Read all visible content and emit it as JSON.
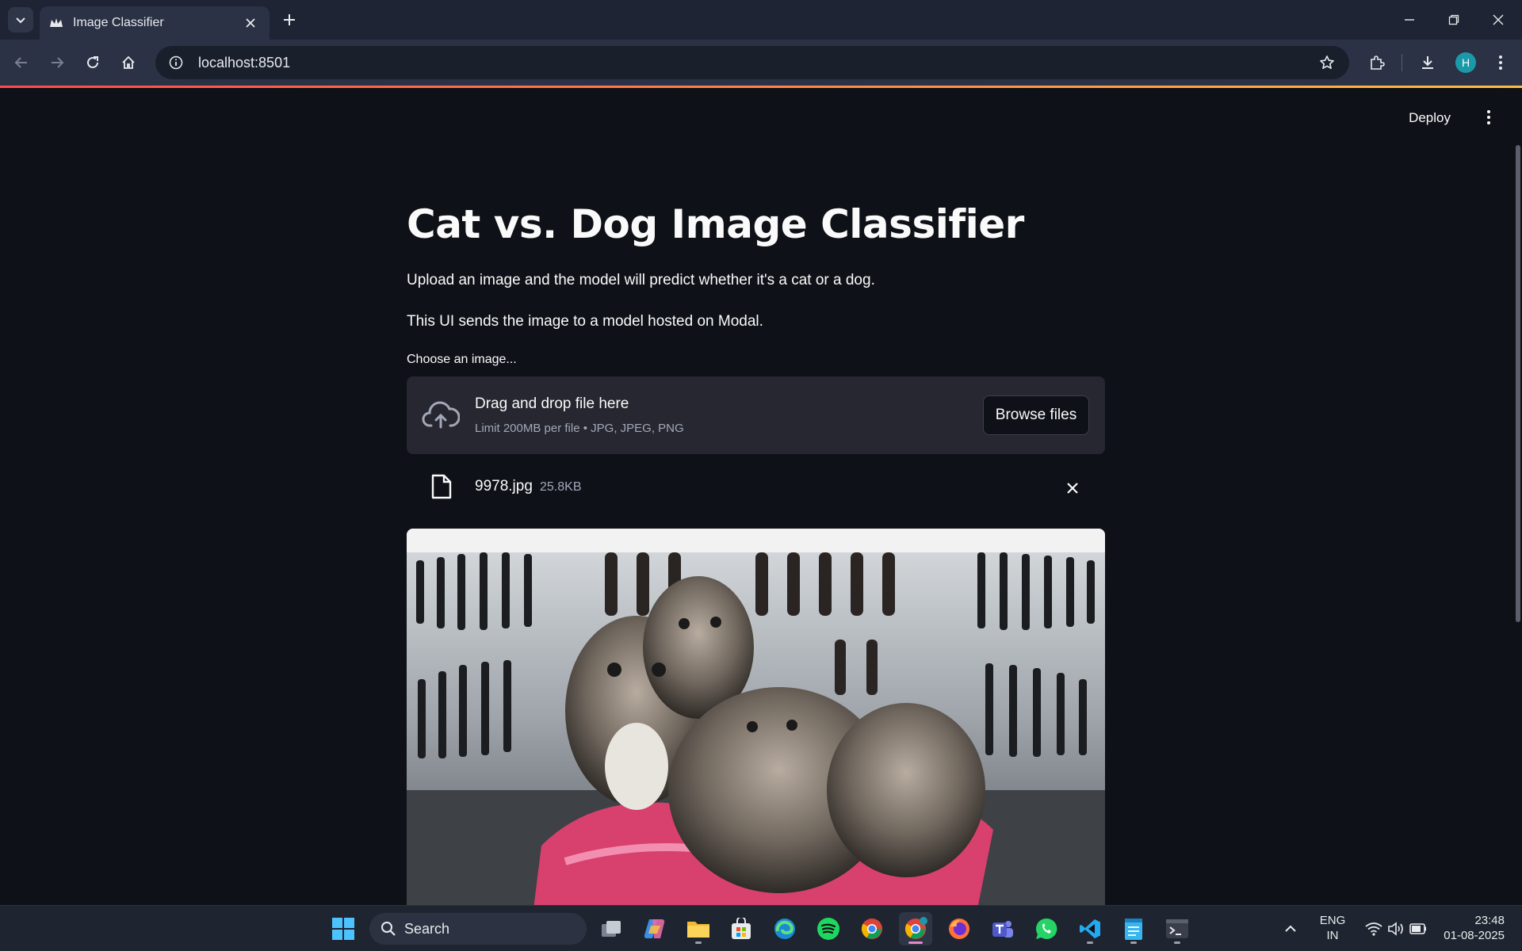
{
  "browser": {
    "tab_title": "Image Classifier",
    "url": "localhost:8501",
    "profile_initial": "H"
  },
  "app": {
    "deploy_label": "Deploy",
    "title": "Cat vs. Dog Image Classifier",
    "description": "Upload an image and the model will predict whether it's a cat or a dog.",
    "note": "This UI sends the image to a model hosted on Modal.",
    "uploader": {
      "label": "Choose an image...",
      "drag_drop": "Drag and drop file here",
      "limit": "Limit 200MB per file • JPG, JPEG, PNG",
      "browse_label": "Browse files"
    },
    "file": {
      "name": "9978.jpg",
      "size": "25.8KB"
    }
  },
  "taskbar": {
    "search_label": "Search",
    "lang_top": "ENG",
    "lang_bottom": "IN",
    "time": "23:48",
    "date": "01-08-2025",
    "apps": [
      "task-view",
      "copilot",
      "file-explorer",
      "microsoft-store",
      "edge",
      "spotify",
      "chrome-profile",
      "chrome-active",
      "firefox",
      "teams",
      "whatsapp",
      "vscode",
      "notepad",
      "terminal"
    ]
  },
  "colors": {
    "page_bg": "#0e1117",
    "accent_start": "#ff4b4b",
    "accent_end": "#ffbd45",
    "uploader_bg": "#262730"
  }
}
